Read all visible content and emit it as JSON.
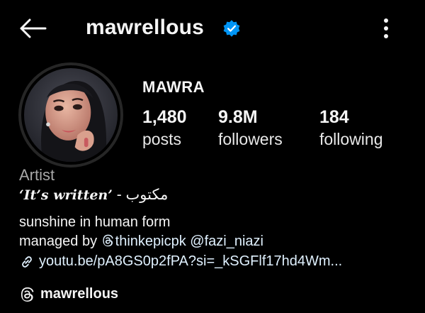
{
  "header": {
    "username": "mawrellous",
    "icons": {
      "back": "back-arrow-icon",
      "verified": "verified-badge-icon",
      "more": "more-vertical-icon"
    },
    "verified_color": "#0095f6"
  },
  "profile": {
    "display_name": "MAWRA",
    "stats": {
      "posts": {
        "value": "1,480",
        "label": "posts"
      },
      "followers": {
        "value": "9.8M",
        "label": "followers"
      },
      "following": {
        "value": "184",
        "label": "following"
      }
    },
    "category": "Artist",
    "bio": {
      "quote_script": "‘It’s written’",
      "quote_rest": " - مكتوب",
      "line1": "sunshine in human form",
      "managed_prefix": "managed by ",
      "mention1": "thinkepicpk",
      "mention2": "@fazi_niazi",
      "link": "youtu.be/pA8GS0p2fPA?si=_kSGFlf17hd4Wm..."
    },
    "threads_handle": "mawrellous"
  },
  "colors": {
    "background": "#000000",
    "text": "#f5f5f5",
    "secondary": "#a8a8a8",
    "link": "#e0f1ff"
  }
}
